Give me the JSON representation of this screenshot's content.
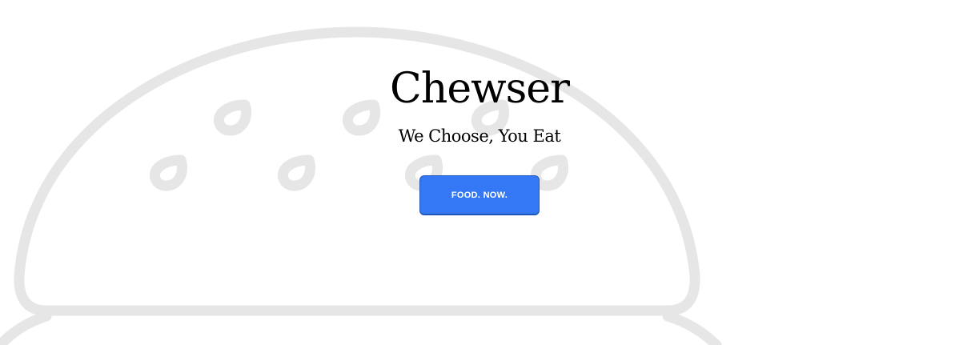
{
  "hero": {
    "title": "Chewser",
    "tagline": "We Choose, You Eat",
    "cta_label": "FOOD. NOW."
  },
  "background": {
    "icon": "burger-outline-icon",
    "stroke_color": "#e6e6e6"
  },
  "colors": {
    "button": "#3478f6",
    "button_border": "#1f57b8",
    "button_text": "#ffffff",
    "text": "#000000"
  }
}
